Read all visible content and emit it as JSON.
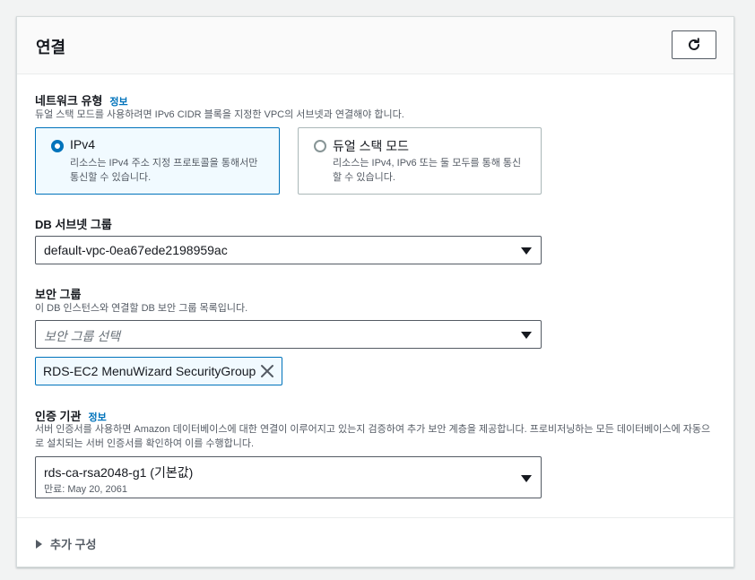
{
  "section": {
    "title": "연결"
  },
  "network": {
    "label": "네트워크 유형",
    "info": "정보",
    "description": "듀얼 스택 모드를 사용하려면 IPv6 CIDR 블록을 지정한 VPC의 서브넷과 연결해야 합니다.",
    "options": [
      {
        "title": "IPv4",
        "description": "리소스는 IPv4 주소 지정 프로토콜을 통해서만 통신할 수 있습니다.",
        "selected": true
      },
      {
        "title": "듀얼 스택 모드",
        "description": "리소스는 IPv4, IPv6 또는 둘 모두를 통해 통신할 수 있습니다.",
        "selected": false
      }
    ]
  },
  "subnet": {
    "label": "DB 서브넷 그룹",
    "value": "default-vpc-0ea67ede2198959ac"
  },
  "security": {
    "label": "보안 그룹",
    "description": "이 DB 인스턴스와 연결할 DB 보안 그룹 목록입니다.",
    "placeholder": "보안 그룹 선택",
    "token": "RDS-EC2 MenuWizard SecurityGroup"
  },
  "ca": {
    "label": "인증 기관",
    "info": "정보",
    "description": "서버 인증서를 사용하면 Amazon 데이터베이스에 대한 연결이 이루어지고 있는지 검증하여 추가 보안 계층을 제공합니다. 프로비저닝하는 모든 데이터베이스에 자동으로 설치되는 서버 인증서를 확인하여 이를 수행합니다.",
    "value": "rds-ca-rsa2048-g1 (기본값)",
    "expiry": "만료: May 20, 2061"
  },
  "additional": {
    "label": "추가 구성"
  },
  "colors": {
    "accent": "#0073bb",
    "border": "#545b64"
  },
  "icons": {
    "refresh": "refresh-icon",
    "close": "close-icon",
    "caret": "caret-down-icon",
    "expand": "caret-right-icon"
  }
}
